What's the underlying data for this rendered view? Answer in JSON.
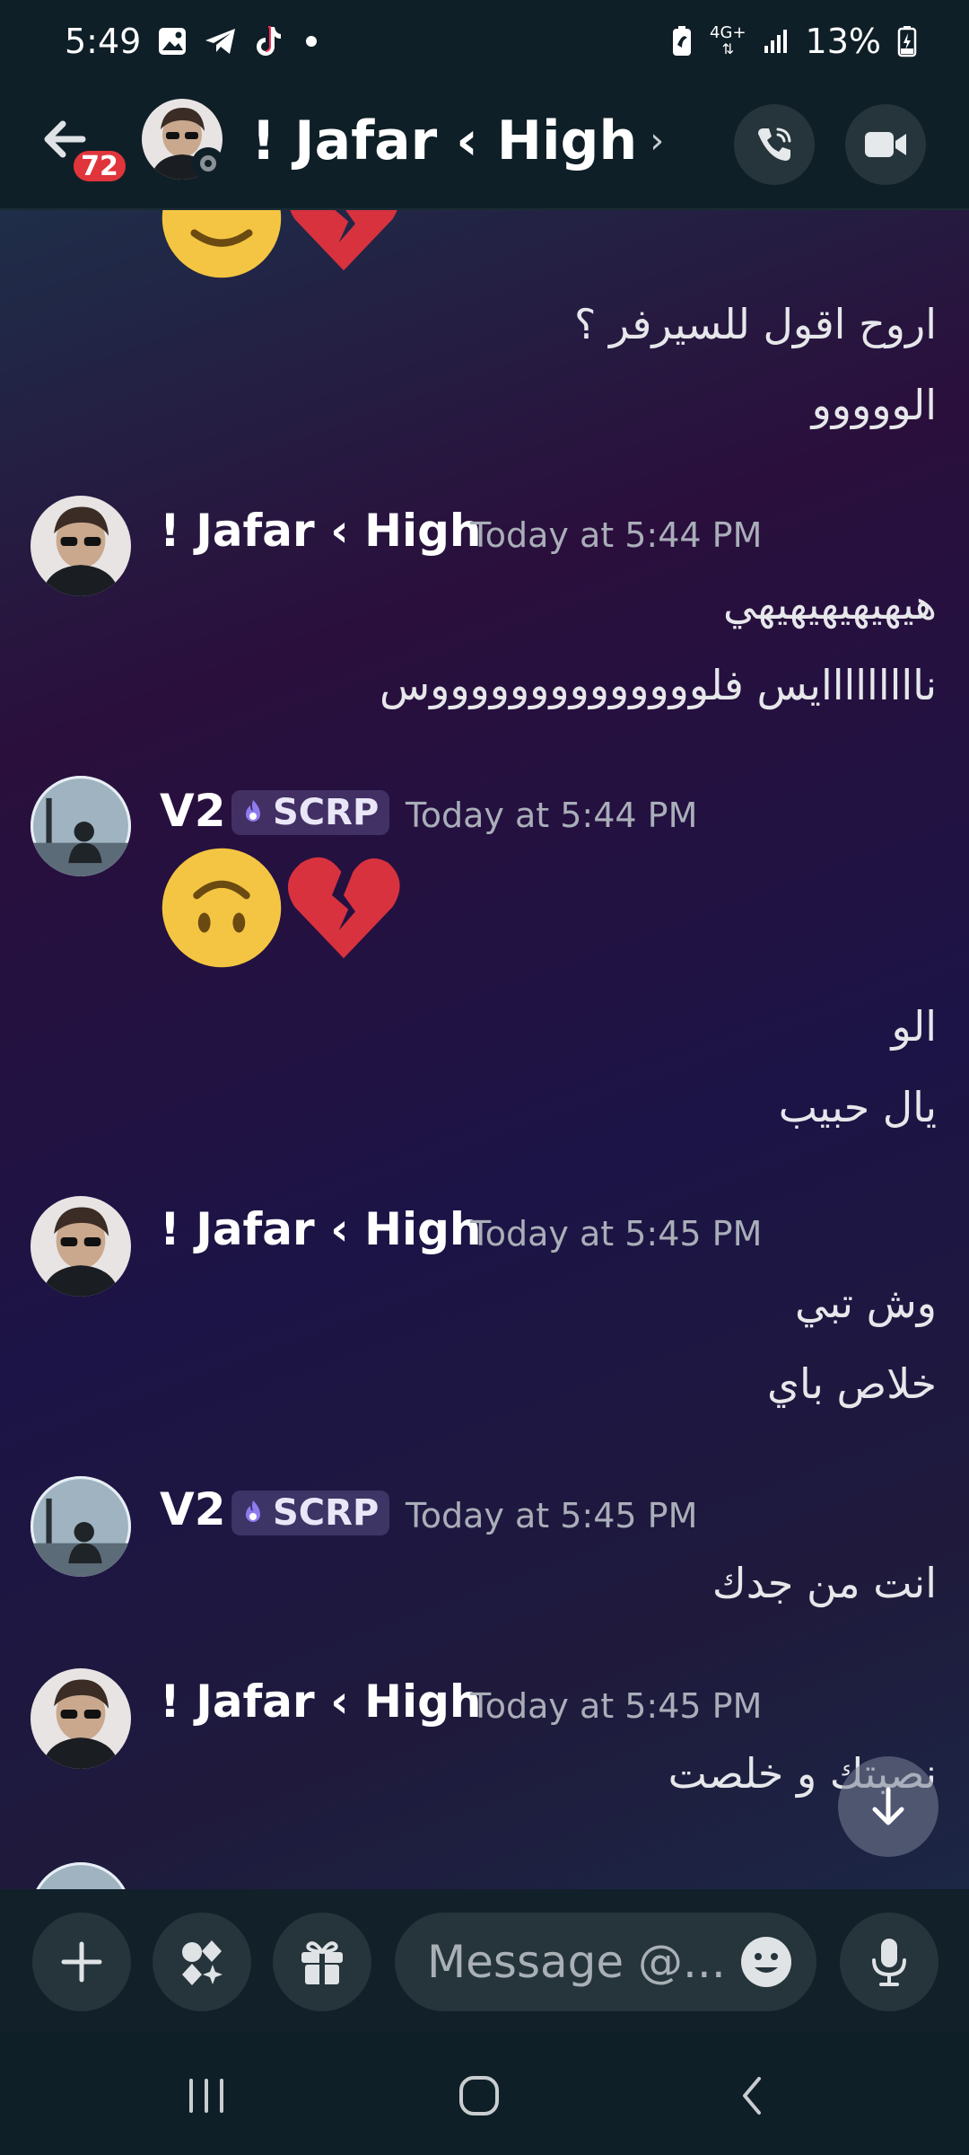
{
  "status_bar": {
    "time": "5:49",
    "network": "4G+",
    "battery": "13%",
    "icons": [
      "gallery-icon",
      "telegram-icon",
      "tiktok-icon",
      "notification-dot",
      "battery-saver-icon",
      "signal-icon",
      "battery-charging-icon"
    ]
  },
  "header": {
    "back_badge": "72",
    "title": "! Jafar ‹ High",
    "chevron": "›",
    "icons": [
      "back-arrow-icon",
      "voice-call-icon",
      "video-call-icon"
    ]
  },
  "messages": [
    {
      "type": "continuation",
      "emojis": [
        "smiling-face",
        "broken-heart"
      ],
      "lines": [
        "اروح اقول للسيرفر ؟",
        "الووووو"
      ]
    },
    {
      "author": "! Jafar ‹ High",
      "timestamp": "Today at 5:44 PM",
      "lines": [
        "هيهيهيهيهيهي",
        "نااااااااايس فلووووووووووووووس"
      ]
    },
    {
      "author": "V2",
      "tag": "SCRP",
      "timestamp": "Today at 5:44 PM",
      "emojis": [
        "upside-down-face",
        "broken-heart"
      ],
      "lines": [
        "الو",
        "يال حبيب"
      ]
    },
    {
      "author": "! Jafar ‹ High",
      "timestamp": "Today at 5:45 PM",
      "lines": [
        "وش تبي",
        "خلاص باي"
      ]
    },
    {
      "author": "V2",
      "tag": "SCRP",
      "timestamp": "Today at 5:45 PM",
      "lines": [
        "انت من جدك"
      ]
    },
    {
      "author": "! Jafar ‹ High",
      "timestamp": "Today at 5:45 PM",
      "lines": [
        "نصبتك و خلصت"
      ]
    }
  ],
  "composer": {
    "placeholder": "Message @...",
    "icons": [
      "plus-icon",
      "apps-icon",
      "gift-icon",
      "emoji-icon",
      "microphone-icon"
    ]
  },
  "colors": {
    "status_header_bg": "#0f1f27",
    "badge_red": "#e0353b",
    "composer_button_bg": "#26343b",
    "timestamp_gray": "#a9aeb8"
  }
}
